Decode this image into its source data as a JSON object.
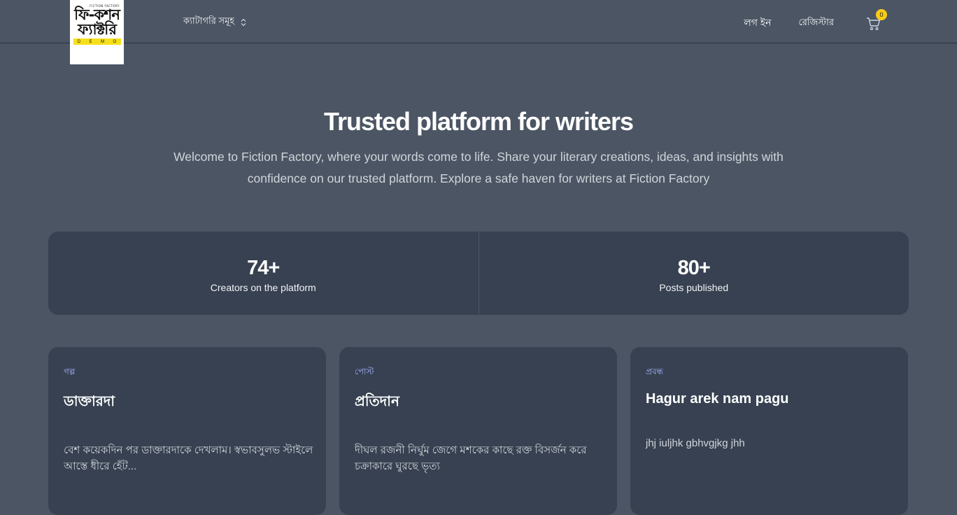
{
  "logo": {
    "tagline": "FICTION FACTORY",
    "line1": "ফি-কশন",
    "line2": "ফ্যাক্টরি",
    "demo_letters": [
      "D",
      "E",
      "M",
      "O"
    ]
  },
  "nav": {
    "categories_label": "ক্যাটাগরি সমূহ",
    "login_label": "লগ ইন",
    "register_label": "রেজিস্টার",
    "cart_count": "0"
  },
  "hero": {
    "title": "Trusted platform for writers",
    "subtitle": "Welcome to Fiction Factory, where your words come to life. Share your literary creations, ideas, and insights with confidence on our trusted platform. Explore a safe haven for writers at Fiction Factory"
  },
  "stats": [
    {
      "value": "74+",
      "label": "Creators on the platform"
    },
    {
      "value": "80+",
      "label": "Posts published"
    }
  ],
  "posts": [
    {
      "category": "গল্প",
      "title": "ডাক্তারদা",
      "excerpt": "বেশ কয়েকদিন পর ডাক্তারদাকে দেখলাম। স্বভাবসুলভ স্টাইলে আস্তে ধীরে হেঁট..."
    },
    {
      "category": "পোস্ট",
      "title": "প্রতিদান",
      "excerpt": "দীঘল রজনী নির্ঘুম জেগে মশকের কাছে রক্ত বিসর্জন করে চক্রাকারে ঘুরছে ভৃত্য"
    },
    {
      "category": "প্রবন্ধ",
      "title": "Hagur arek nam pagu",
      "excerpt": "jhj iuljhk gbhvgjkg jhh"
    }
  ],
  "colors": {
    "background": "#4b5563",
    "card": "#374151",
    "accent_category": "#a5b4fc",
    "badge": "#facc15",
    "logo_demo_band": "#f6e01b"
  },
  "icons": {
    "categories_toggle": "chevron-up-down-icon",
    "cart": "shopping-cart-icon"
  }
}
